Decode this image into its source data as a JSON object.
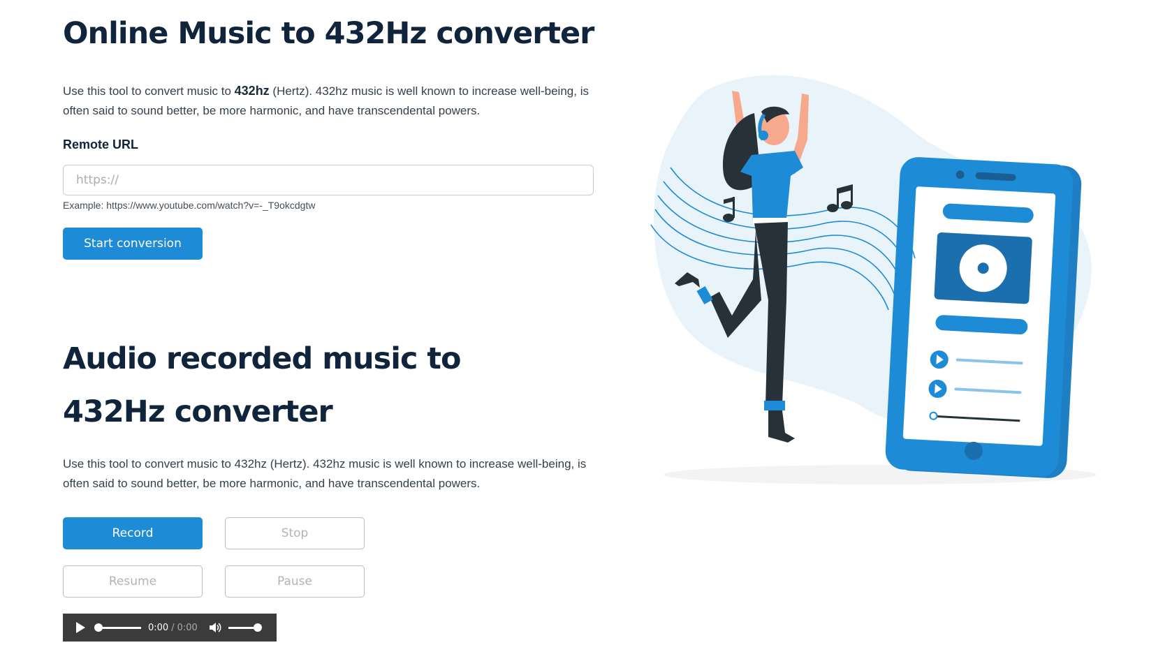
{
  "section1": {
    "title": "Online Music to 432Hz converter",
    "desc_before": "Use this tool to convert music to ",
    "desc_bold": "432hz",
    "desc_after": " (Hertz). 432hz music is well known to increase well-being, is often said to sound better, be more harmonic, and have transcendental powers.",
    "url_label": "Remote URL",
    "url_placeholder": "https://",
    "url_value": "",
    "url_example": "Example: https://www.youtube.com/watch?v=-_T9okcdgtw",
    "start_button": "Start conversion"
  },
  "section2": {
    "title": "Audio recorded music to 432Hz converter",
    "desc": "Use this tool to convert music to 432hz (Hertz). 432hz music is well known to increase well-being, is often said to sound better, be more harmonic, and have transcendental powers.",
    "record_button": "Record",
    "stop_button": "Stop",
    "resume_button": "Resume",
    "pause_button": "Pause"
  },
  "player": {
    "current_time": "0:00",
    "separator": "/",
    "total_time": "0:00",
    "progress": 0,
    "volume": 1,
    "icons": [
      "play-icon",
      "volume-icon"
    ]
  },
  "illustration": {
    "icons": [
      "dancing-woman-illustration",
      "phone-icon",
      "music-note-icon",
      "vinyl-disc-icon"
    ],
    "colors": {
      "accent": "#1e8bd6",
      "dark": "#263238",
      "background_blob": "#e9f3fa",
      "skin": "#f6a98c"
    }
  },
  "colors": {
    "primary": "#1e8bd6",
    "heading": "#10243b",
    "text": "#34404c",
    "player_bg": "#3b3b3b"
  }
}
